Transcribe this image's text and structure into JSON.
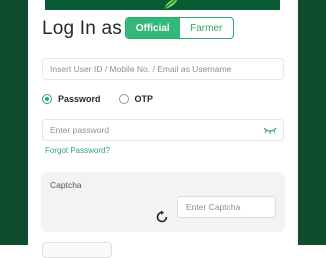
{
  "header": {
    "title": "Log In as"
  },
  "login_type": {
    "options": [
      "Official",
      "Farmer"
    ],
    "selected": "Official"
  },
  "user_id": {
    "placeholder": "Insert User ID / Mobile No. / Email as Username"
  },
  "auth_method": {
    "options": [
      "Password",
      "OTP"
    ],
    "selected": "Password"
  },
  "password": {
    "placeholder": "Enter password"
  },
  "forgot_password": {
    "label": "Forgot Password?"
  },
  "captcha": {
    "label": "Captcha",
    "placeholder": "Enter Captcha"
  },
  "colors": {
    "brand_dark": "#0f4d2f",
    "accent": "#33b87a",
    "link": "#2fa86b"
  },
  "icons": {
    "refresh": "refresh-icon",
    "eye": "eye-hidden-icon"
  }
}
